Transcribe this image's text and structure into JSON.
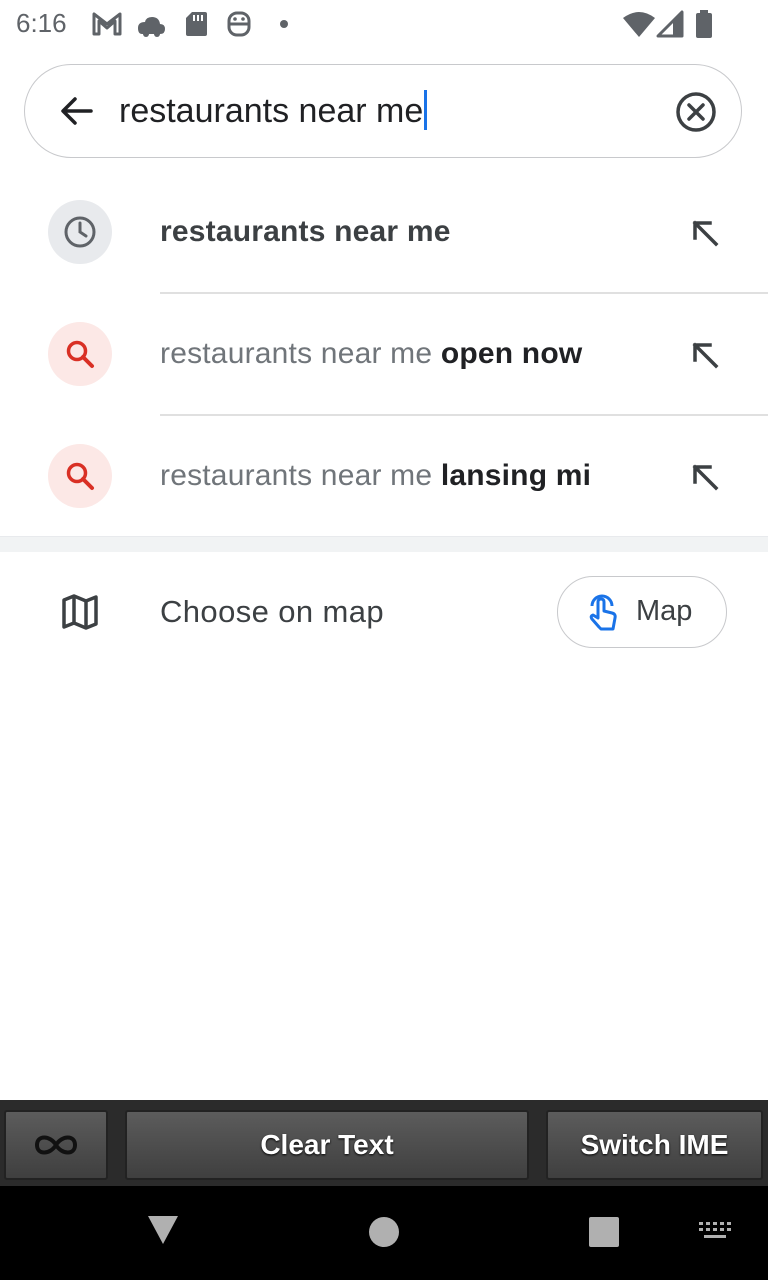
{
  "status_bar": {
    "time": "6:16",
    "left_icons": [
      "gmail-icon",
      "cloud-icon",
      "sd-card-icon",
      "smiley-icon",
      "dot-icon"
    ],
    "right_icons": [
      "wifi-icon",
      "signal-icon",
      "battery-icon"
    ]
  },
  "search": {
    "query": "restaurants near me"
  },
  "suggestions": [
    {
      "type": "history",
      "icon": "clock-icon",
      "text": "restaurants near me"
    },
    {
      "type": "search",
      "icon": "search-icon",
      "prefix": "restaurants near me",
      "completion": "open now"
    },
    {
      "type": "search",
      "icon": "search-icon",
      "prefix": "restaurants near me",
      "completion": "lansing mi"
    }
  ],
  "choose_on_map": {
    "label": "Choose on map",
    "button_label": "Map"
  },
  "keyboard_bar": {
    "clear_label": "Clear Text",
    "switch_label": "Switch IME"
  },
  "colors": {
    "accent_blue": "#1a73e8",
    "search_icon_red": "#d93025",
    "history_bg": "#e8eaed",
    "search_bg": "#fce8e6"
  }
}
